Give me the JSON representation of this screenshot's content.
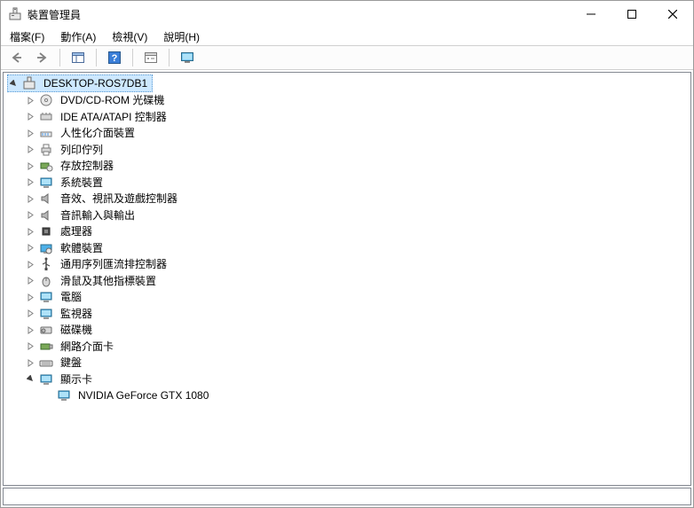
{
  "window": {
    "title": "裝置管理員"
  },
  "menu": {
    "file": "檔案(F)",
    "action": "動作(A)",
    "view": "檢視(V)",
    "help": "說明(H)"
  },
  "tree": {
    "root": "DESKTOP-ROS7DB1",
    "cat": {
      "dvd": "DVD/CD-ROM 光碟機",
      "ide": "IDE ATA/ATAPI 控制器",
      "hid": "人性化介面裝置",
      "printq": "列印佇列",
      "storage": "存放控制器",
      "sysdev": "系統裝置",
      "audiogame": "音效、視訊及遊戲控制器",
      "audioio": "音訊輸入與輸出",
      "cpu": "處理器",
      "softdev": "軟體裝置",
      "usb": "通用序列匯流排控制器",
      "mouse": "滑鼠及其他指標裝置",
      "computer": "電腦",
      "monitor": "監視器",
      "disk": "磁碟機",
      "nic": "網路介面卡",
      "keyboard": "鍵盤",
      "display": "顯示卡"
    },
    "leaf": {
      "gpu": "NVIDIA GeForce GTX 1080"
    }
  }
}
